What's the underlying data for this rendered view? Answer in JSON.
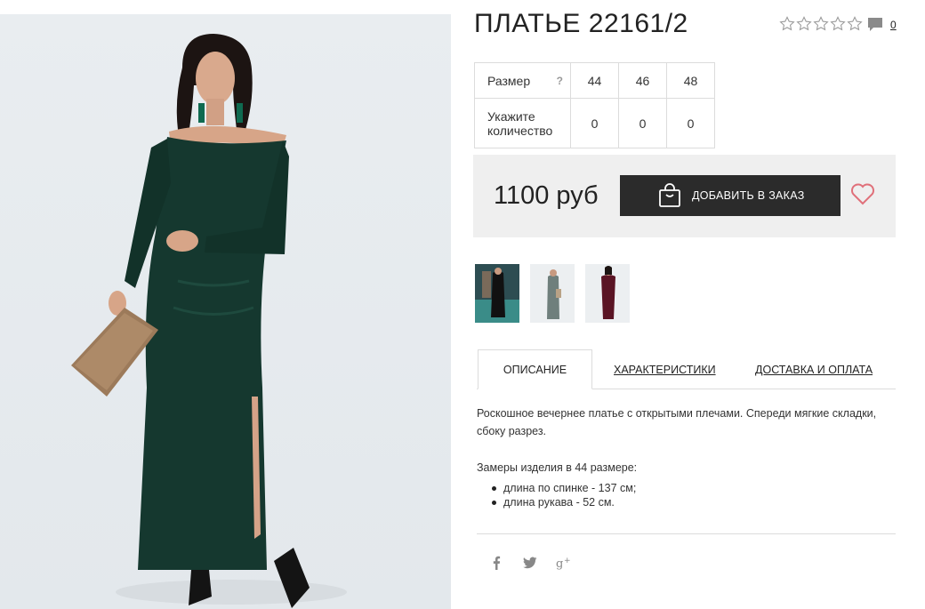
{
  "product": {
    "title": "ПЛАТЬЕ 22161/2",
    "comment_count": "0",
    "rating_stars": 5,
    "rating_filled": 0
  },
  "sizes": {
    "label": "Размер",
    "help": "?",
    "values": [
      "44",
      "46",
      "48"
    ],
    "qty_label": "Укажите количество",
    "quantities": [
      "0",
      "0",
      "0"
    ]
  },
  "buy": {
    "price": "1100 руб",
    "add_label": "ДОБАВИТЬ В ЗАКАЗ"
  },
  "tabs": {
    "description": "ОПИСАНИЕ",
    "specs": "ХАРАКТЕРИСТИКИ",
    "delivery": "ДОСТАВКА И ОПЛАТА"
  },
  "description": {
    "text": "Роскошное вечернее платье с открытыми плечами. Спереди мягкие складки, сбоку разрез.",
    "measure_title": "Замеры изделия в 44 размере:",
    "measures": [
      "длина по спинке - 137 см;",
      "длина рукава - 52 см."
    ]
  },
  "colors": {
    "dark": "#2b2b2b",
    "panel": "#efefef",
    "heart": "#e0707a",
    "dress": "#15382f"
  },
  "icons": {
    "stars": "star-outline-icon",
    "comment": "comment-icon",
    "bag": "shopping-bag-icon",
    "heart": "heart-icon",
    "social": [
      "facebook-icon",
      "twitter-icon",
      "google-plus-icon"
    ]
  }
}
